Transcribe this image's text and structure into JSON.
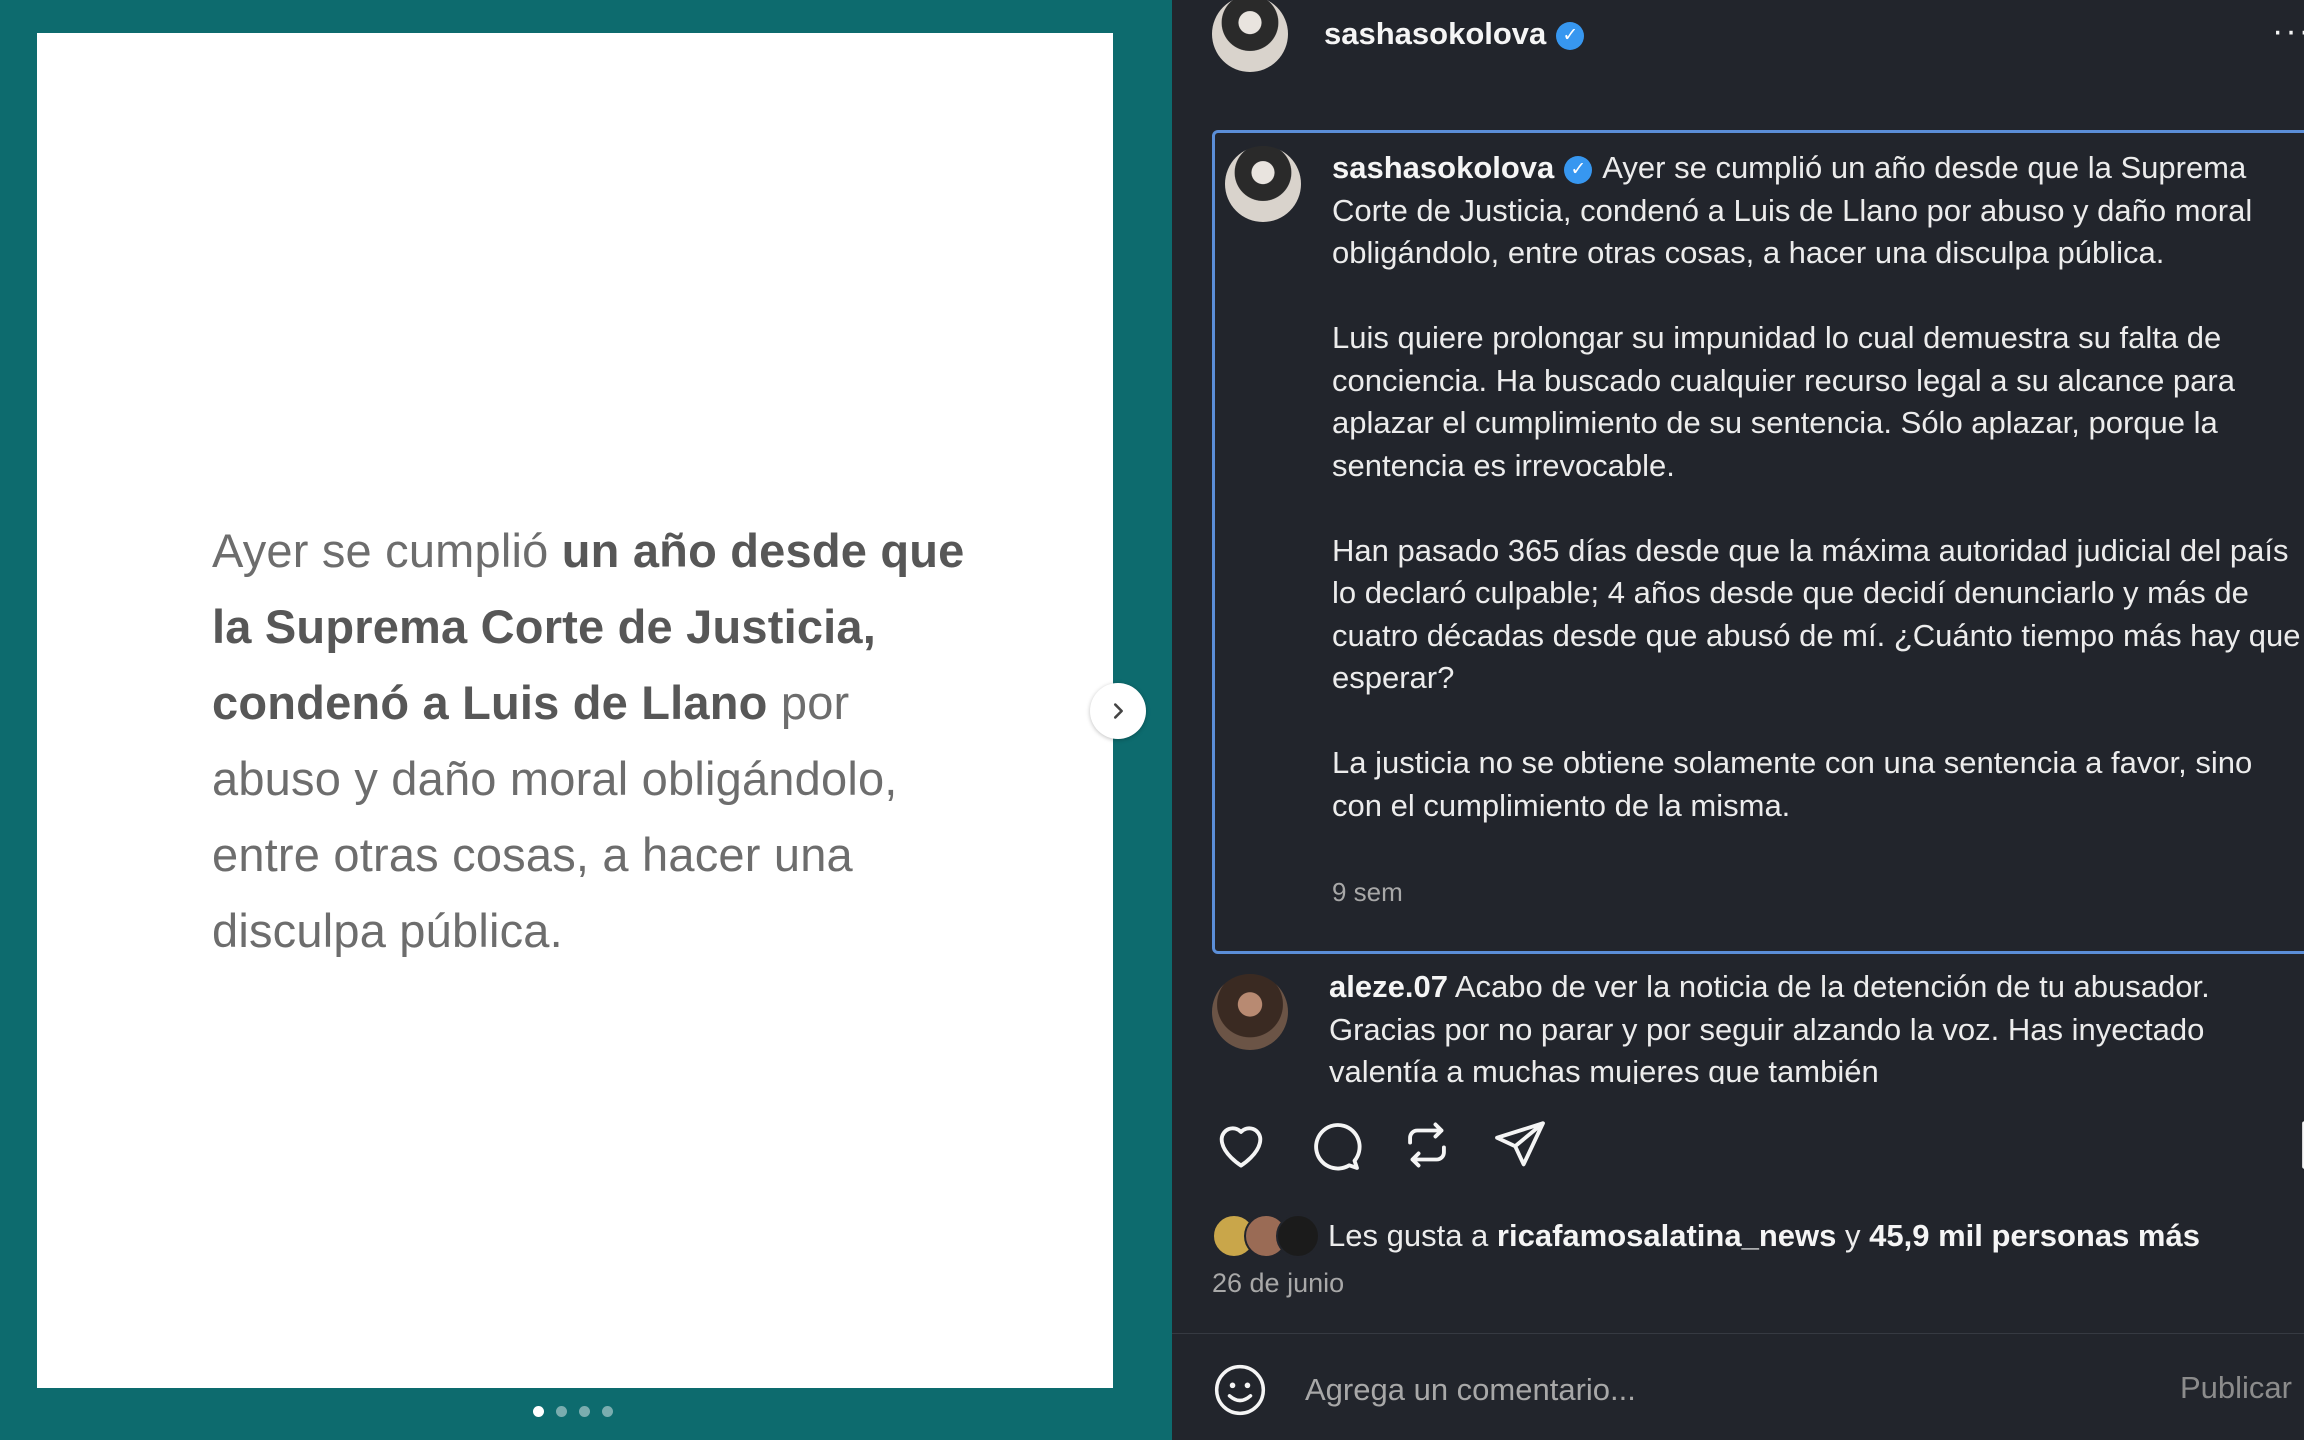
{
  "slide": {
    "parts": [
      {
        "text": "Ayer se cumplió ",
        "bold": false
      },
      {
        "text": "un año desde que la Suprema Corte de Justicia, condenó a Luis de Llano",
        "bold": true
      },
      {
        "text": " por abuso y daño moral obligándolo, entre otras cosas, a hacer una disculpa pública.",
        "bold": false
      }
    ],
    "total_slides": 4,
    "active_slide": 1
  },
  "header": {
    "username": "sashasokolova",
    "more_label": "···"
  },
  "caption": {
    "username": "sashasokolova",
    "paragraphs": [
      "Ayer se cumplió un año desde que la Suprema Corte de Justicia, condenó a Luis de Llano por abuso y daño moral obligándolo, entre otras cosas, a hacer una disculpa pública.",
      "Luis quiere prolongar su impunidad lo cual demuestra su falta de conciencia. Ha buscado cualquier recurso legal a su alcance para aplazar el cumplimiento de su sentencia. Sólo aplazar, porque la sentencia es irrevocable.",
      "Han pasado 365 días desde que la máxima autoridad judicial del país lo declaró culpable; 4 años desde que decidí denunciarlo y más de cuatro décadas desde que abusó de mí. ¿Cuánto tiempo más hay que esperar?",
      "La justicia no se obtiene solamente con una sentencia a favor, sino con el cumplimiento de la misma."
    ],
    "time": "9 sem"
  },
  "comment": {
    "username": "aleze.07",
    "text": "Acabo de ver la noticia de la detención de tu abusador. Gracias por no parar y por seguir alzando la voz. Has inyectado valentía a muchas mujeres que también"
  },
  "likes": {
    "prefix": "Les gusta a",
    "user": "ricafamosalatina_news",
    "connector": "y",
    "others": "45,9 mil personas más"
  },
  "date": "26 de junio",
  "comment_bar": {
    "placeholder": "Agrega un comentario...",
    "publish_label": "Publicar"
  },
  "colors": {
    "media_bg": "#0d6b6e",
    "post_bg": "#22252c",
    "verified": "#3797f0",
    "focus_border": "#5b8ed8"
  }
}
